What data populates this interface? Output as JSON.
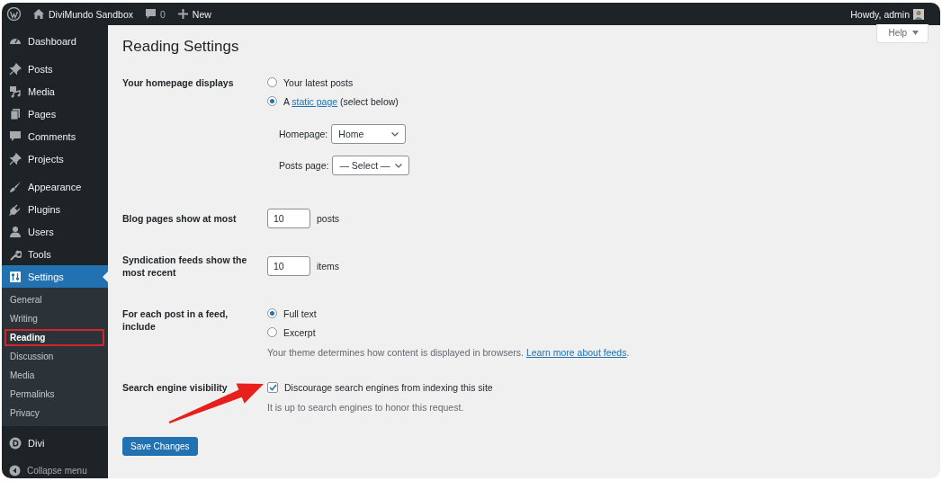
{
  "admin_bar": {
    "site_name": "DiviMundo Sandbox",
    "comments_count": "0",
    "new_label": "New",
    "greeting": "Howdy, admin"
  },
  "help_button": "Help",
  "sidebar": {
    "sections": [
      {
        "items": [
          {
            "label": "Dashboard",
            "selected": false
          }
        ]
      },
      {
        "items": [
          {
            "label": "Posts",
            "selected": false
          },
          {
            "label": "Media",
            "selected": false
          },
          {
            "label": "Pages",
            "selected": false
          },
          {
            "label": "Comments",
            "selected": false
          },
          {
            "label": "Projects",
            "selected": false
          }
        ]
      },
      {
        "items": [
          {
            "label": "Appearance",
            "selected": false
          },
          {
            "label": "Plugins",
            "selected": false
          },
          {
            "label": "Users",
            "selected": false
          },
          {
            "label": "Tools",
            "selected": false
          },
          {
            "label": "Settings",
            "selected": true,
            "children": [
              {
                "label": "General",
                "selected": false,
                "highlighted": false
              },
              {
                "label": "Writing",
                "selected": false,
                "highlighted": false
              },
              {
                "label": "Reading",
                "selected": true,
                "highlighted": true
              },
              {
                "label": "Discussion",
                "selected": false,
                "highlighted": false
              },
              {
                "label": "Media",
                "selected": false,
                "highlighted": false
              },
              {
                "label": "Permalinks",
                "selected": false,
                "highlighted": false
              },
              {
                "label": "Privacy",
                "selected": false,
                "highlighted": false
              }
            ]
          }
        ]
      },
      {
        "items": [
          {
            "label": "Divi",
            "selected": false
          }
        ]
      }
    ],
    "collapse_label": "Collapse menu"
  },
  "page": {
    "title": "Reading Settings",
    "settings": [
      {
        "kind": "radio",
        "label": "Your homepage displays",
        "options": [
          {
            "text": "Your latest posts",
            "selected": false
          },
          {
            "text": "A",
            "link": "static page",
            "after": "(select below)",
            "selected": true
          }
        ],
        "dropdowns": [
          {
            "label": "Homepage:",
            "value": "Home"
          },
          {
            "label": "Posts page:",
            "value": "— Select —"
          }
        ]
      },
      {
        "kind": "number",
        "label": "Blog pages show at most",
        "value": "10",
        "unit": "posts"
      },
      {
        "kind": "number",
        "label": "Syndication feeds show the most recent",
        "value": "10",
        "unit": "items"
      },
      {
        "kind": "radio",
        "label": "For each post in a feed, include",
        "options": [
          {
            "text": "Full text",
            "selected": true
          },
          {
            "text": "Excerpt",
            "selected": false
          }
        ],
        "description": {
          "text": "Your theme determines how content is displayed in browsers.",
          "link": "Learn more about feeds",
          "after": "."
        }
      },
      {
        "kind": "checkbox",
        "label": "Search engine visibility",
        "text": "Discourage search engines from indexing this site",
        "checked": true,
        "description": {
          "text": "It is up to search engines to honor this request."
        }
      }
    ],
    "save_button": "Save Changes"
  }
}
